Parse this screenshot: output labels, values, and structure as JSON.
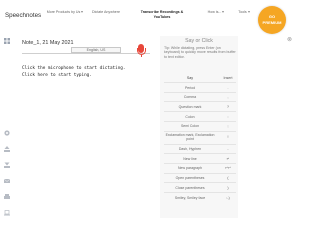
{
  "brand": "Speechnotes",
  "nav": [
    {
      "label": "More Products by Us",
      "has_caret": true,
      "bold": false
    },
    {
      "label": "Dictate Anywhere",
      "has_caret": false,
      "bold": false
    },
    {
      "label": "Transcribe Recordings & YouTubes",
      "has_caret": false,
      "bold": true
    },
    {
      "label": "How is...",
      "has_caret": true,
      "bold": false
    },
    {
      "label": "Tools",
      "has_caret": true,
      "bold": false
    }
  ],
  "premium": {
    "line1": "GO",
    "line2": "PREMIUM",
    "color": "#f5a623"
  },
  "editor": {
    "note_title": "Note_1, 21 May 2021",
    "language": "English, US",
    "line1": "Click the microphone to start dictating.",
    "line2": "Click here to start typing."
  },
  "mic_color": "#e8473a",
  "help": {
    "title": "Say or Click",
    "tip": "Tip: While dictating, press Enter (on keyboard) to quickly move results from buffer to text editor.",
    "col_say": "Say",
    "col_insert": "Insert",
    "rows": [
      {
        "say": "Period",
        "insert": "."
      },
      {
        "say": "Comma",
        "insert": ","
      },
      {
        "say": "Question mark",
        "insert": "?"
      },
      {
        "say": "Colon",
        "insert": ":"
      },
      {
        "say": "Semi Colon",
        "insert": ";"
      },
      {
        "say": "Exclamation mark, Exclamation point",
        "insert": "!"
      },
      {
        "say": "Dash, Hyphen",
        "insert": "-"
      },
      {
        "say": "New line",
        "insert": "↵"
      },
      {
        "say": "New paragraph",
        "insert": "↵↵"
      },
      {
        "say": "Open parentheses",
        "insert": "("
      },
      {
        "say": "Close parentheses",
        "insert": ")"
      },
      {
        "say": "Smiley, Smiley face",
        "insert": ":-)"
      }
    ]
  },
  "rail_icons": [
    "grid-icon",
    "settings-icon",
    "upload-icon",
    "download-icon",
    "email-icon",
    "print-icon",
    "laptop-icon"
  ],
  "close_glyph": "⊗"
}
